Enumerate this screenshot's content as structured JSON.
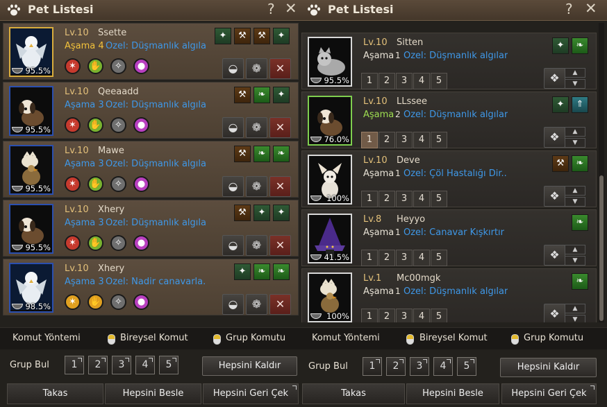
{
  "left_window": {
    "title": "Pet Listesi",
    "help": "?",
    "close": "✕",
    "pets": [
      {
        "level": "Lv.10",
        "name": "Ssette",
        "stage": "Aşama 4",
        "stage_color": "yellow",
        "special": "Özel: Düşmanlık algılar",
        "percent": "95.5%",
        "frame": "gold",
        "animal": "bird"
      },
      {
        "level": "Lv.10",
        "name": "Qeeaadd",
        "stage": "Aşama 3",
        "stage_color": "blue",
        "special": "Özel: Düşmanlık algılar",
        "percent": "95.5%",
        "frame": "blue",
        "animal": "dog"
      },
      {
        "level": "Lv.10",
        "name": "Mawe",
        "stage": "Aşama 3",
        "stage_color": "blue",
        "special": "Özel: Düşmanlık algılar",
        "percent": "95.5%",
        "frame": "blue",
        "animal": "chick"
      },
      {
        "level": "Lv.10",
        "name": "Xhery",
        "stage": "Aşama 3",
        "stage_color": "blue",
        "special": "Özel: Düşmanlık algılar",
        "percent": "95.5%",
        "frame": "blue",
        "animal": "dog"
      },
      {
        "level": "Lv.10",
        "name": "Xhery",
        "stage": "Aşama 3",
        "stage_color": "blue",
        "special": "Özel: Nadir canavarla...",
        "percent": "98.5%",
        "frame": "blue",
        "animal": "bird"
      }
    ],
    "mode": {
      "label": "Komut Yöntemi",
      "individual": "Bireysel Komut",
      "group": "Grup Komutu"
    },
    "group_find": {
      "label": "Grup Bul",
      "slots": [
        "1",
        "2",
        "3",
        "4",
        "5"
      ]
    },
    "remove_all": "Hepsini Kaldır",
    "bottom": {
      "trade": "Takas",
      "feed_all": "Hepsini Besle",
      "recall_all": "Hepsini Geri Çek"
    }
  },
  "right_window": {
    "title": "Pet Listesi",
    "help": "?",
    "close": "✕",
    "pets": [
      {
        "level": "Lv.10",
        "name": "Sitten",
        "stage_word": "Aşama",
        "stage_num": "1",
        "stage_color": "white",
        "special": "Özel: Düşmanlık algılar",
        "percent": "95.5%",
        "frame": "grey",
        "animal": "cat",
        "selected_slot": 0
      },
      {
        "level": "Lv.10",
        "name": "LLssee",
        "stage_word": "Aşama",
        "stage_num": "2",
        "stage_color": "green",
        "special": "Özel: Düşmanlık algılar",
        "percent": "76.0%",
        "frame": "green",
        "animal": "dog",
        "selected_slot": 1
      },
      {
        "level": "Lv.10",
        "name": "Deve",
        "stage_word": "Aşama",
        "stage_num": "1",
        "stage_color": "white",
        "special": "Özel: Çöl Hastalığı Dir...",
        "percent": "100%",
        "frame": "grey",
        "animal": "fox",
        "selected_slot": 0
      },
      {
        "level": "Lv.8",
        "name": "Heyyo",
        "stage_word": "Aşama",
        "stage_num": "1",
        "stage_color": "white",
        "special": "Özel: Canavar Kışkırtır",
        "percent": "41.5%",
        "frame": "grey",
        "animal": "witch",
        "selected_slot": 0
      },
      {
        "level": "Lv.1",
        "name": "Mc00mgk",
        "stage_word": "Aşama",
        "stage_num": "1",
        "stage_color": "white",
        "special": "Özel: Düşmanlık algılar",
        "percent": "100%",
        "frame": "grey",
        "animal": "chick",
        "selected_slot": 0
      }
    ],
    "slots": [
      "1",
      "2",
      "3",
      "4",
      "5"
    ],
    "mode": {
      "label": "Komut Yöntemi",
      "individual": "Bireysel Komut",
      "group": "Grup Komutu"
    },
    "group_find": {
      "label": "Grup Bul",
      "slots": [
        "1",
        "2",
        "3",
        "4",
        "5"
      ]
    },
    "remove_all": "Hepsini Kaldır",
    "bottom": {
      "trade": "Takas",
      "feed_all": "Hepsini Besle",
      "recall_all": "Hepsini Geri Çek"
    }
  },
  "colors": {
    "stage_blue": "#3f98e8",
    "stage_yellow": "#f3c23b",
    "stage_green": "#9fde51",
    "level_gold": "#e3c07a"
  }
}
